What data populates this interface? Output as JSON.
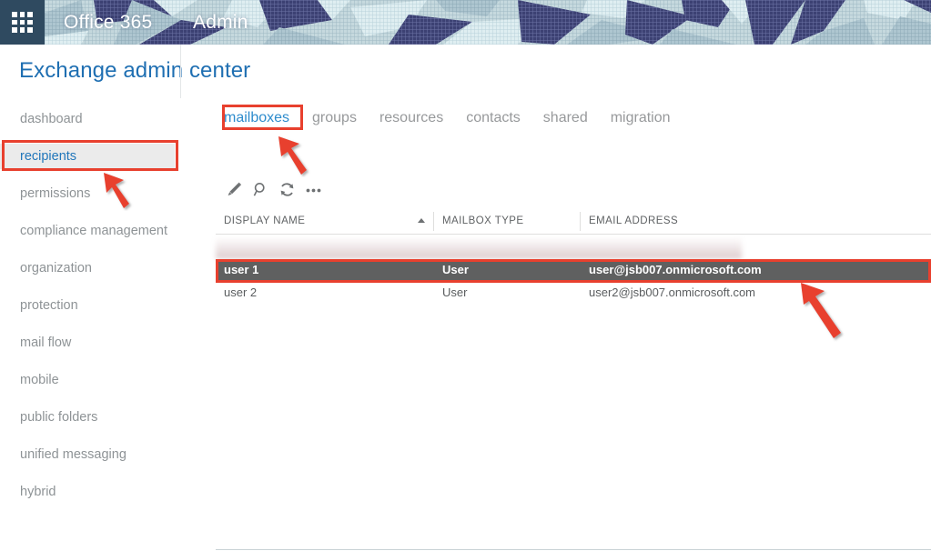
{
  "topbar": {
    "waffle_icon": "app-launcher-waffle-icon",
    "brand": "Office 365",
    "section": "Admin"
  },
  "page_title": "Exchange admin center",
  "sidebar": {
    "items": [
      {
        "label": "dashboard",
        "active": false
      },
      {
        "label": "recipients",
        "active": true
      },
      {
        "label": "permissions",
        "active": false
      },
      {
        "label": "compliance management",
        "active": false
      },
      {
        "label": "organization",
        "active": false
      },
      {
        "label": "protection",
        "active": false
      },
      {
        "label": "mail flow",
        "active": false
      },
      {
        "label": "mobile",
        "active": false
      },
      {
        "label": "public folders",
        "active": false
      },
      {
        "label": "unified messaging",
        "active": false
      },
      {
        "label": "hybrid",
        "active": false
      }
    ]
  },
  "tabs": [
    {
      "label": "mailboxes",
      "active": true
    },
    {
      "label": "groups",
      "active": false
    },
    {
      "label": "resources",
      "active": false
    },
    {
      "label": "contacts",
      "active": false
    },
    {
      "label": "shared",
      "active": false
    },
    {
      "label": "migration",
      "active": false
    }
  ],
  "toolbar": {
    "icons": [
      {
        "name": "edit-pencil-icon",
        "title": "Edit"
      },
      {
        "name": "search-magnifier-icon",
        "title": "Search"
      },
      {
        "name": "refresh-icon",
        "title": "Refresh"
      },
      {
        "name": "more-ellipsis-icon",
        "title": "More options"
      }
    ]
  },
  "table": {
    "columns": [
      {
        "label": "DISPLAY NAME",
        "sort": "ascending"
      },
      {
        "label": "MAILBOX TYPE",
        "sort": ""
      },
      {
        "label": "EMAIL ADDRESS",
        "sort": ""
      }
    ],
    "rows": [
      {
        "display_name": "",
        "mailbox_type": "",
        "email_address": "",
        "state": "redacted"
      },
      {
        "display_name": "user 1",
        "mailbox_type": "User",
        "email_address": "user@jsb007.onmicrosoft.com",
        "state": "selected"
      },
      {
        "display_name": "user 2",
        "mailbox_type": "User",
        "email_address": "user2@jsb007.onmicrosoft.com",
        "state": "normal"
      }
    ]
  },
  "annotations": {
    "accent_color": "#e8402e",
    "highlight_boxes": [
      {
        "name": "recipients-highlight-box",
        "target": "recipients"
      },
      {
        "name": "mailboxes-highlight-box",
        "target": "mailboxes"
      },
      {
        "name": "selected-row-highlight-box",
        "target": "user 1"
      }
    ],
    "arrows": [
      {
        "name": "arrow-to-recipients",
        "direction": "up-left"
      },
      {
        "name": "arrow-to-mailboxes",
        "direction": "up-left"
      },
      {
        "name": "arrow-to-selected-row",
        "direction": "up-left"
      }
    ]
  },
  "colors": {
    "brand_navy": "#2f4a60",
    "title_blue": "#1f6fb2",
    "tab_active_blue": "#2e8ccd",
    "sidebar_active_bg": "#ebebeb",
    "row_selected_bg": "#5f6060",
    "annotation_red": "#e8402e",
    "banner_bg": "#c6d9de",
    "banner_shape": "#3c4173"
  }
}
